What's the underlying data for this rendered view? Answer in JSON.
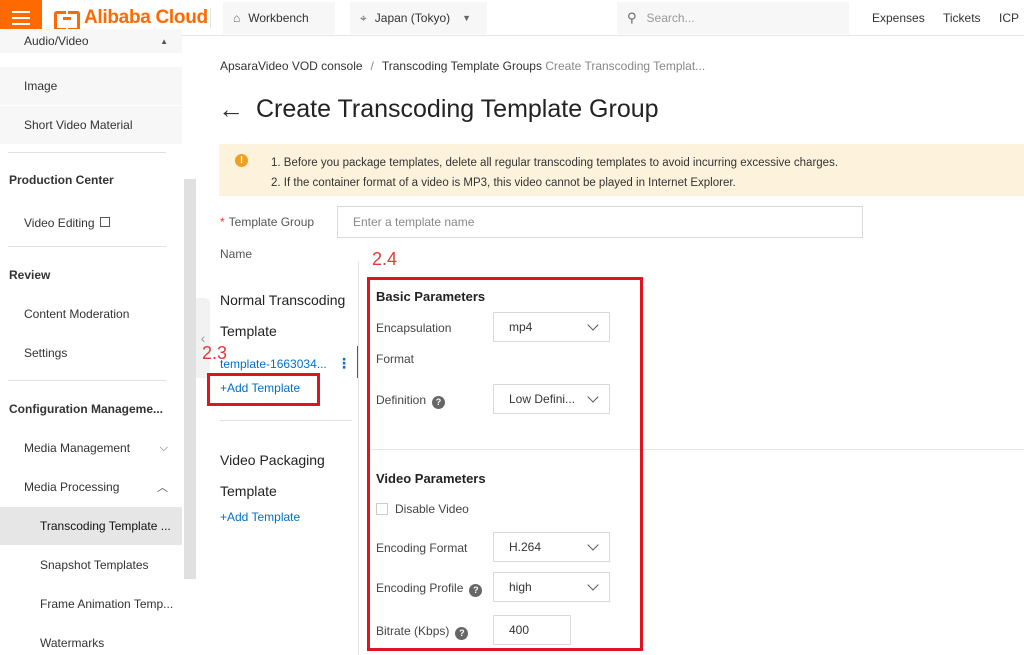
{
  "topbar": {
    "logo_text": "Alibaba Cloud",
    "workbench": "Workbench",
    "region": "Japan (Tokyo)",
    "search_placeholder": "Search...",
    "links": [
      "Expenses",
      "Tickets",
      "ICP"
    ]
  },
  "sidebar": {
    "items_top": [
      "Audio/Video",
      "Image",
      "Short Video Material"
    ],
    "production_center": "Production Center",
    "video_editing": "Video Editing",
    "review": "Review",
    "content_moderation": "Content Moderation",
    "settings": "Settings",
    "config_mgmt": "Configuration Manageme...",
    "media_management": "Media Management",
    "media_processing": "Media Processing",
    "sub_items": [
      "Transcoding Template ...",
      "Snapshot Templates",
      "Frame Animation Temp...",
      "Watermarks"
    ]
  },
  "breadcrumb": {
    "root": "ApsaraVideo VOD console",
    "group": "Transcoding Template Groups",
    "current": "Create Transcoding Templat..."
  },
  "page_title": "Create Transcoding Template Group",
  "notice": {
    "line1": "1. Before you package templates, delete all regular transcoding templates to avoid incurring excessive charges.",
    "line2": "2. If the container format of a video is MP3, this video cannot be played in Internet Explorer."
  },
  "form": {
    "group_label_1": "Template Group",
    "group_label_2": "Name",
    "group_placeholder": "Enter a template name"
  },
  "annotations": {
    "a23": "2.3",
    "a24": "2.4"
  },
  "left_col": {
    "normal_title_1": "Normal Transcoding",
    "normal_title_2": "Template",
    "template_name": "template-1663034...",
    "add_template": "+Add Template",
    "packaging_title_1": "Video Packaging",
    "packaging_title_2": "Template",
    "add_template_2": "+Add Template"
  },
  "basic": {
    "title": "Basic Parameters",
    "encapsulation_1": "Encapsulation",
    "encapsulation_2": "Format",
    "encapsulation_value": "mp4",
    "definition": "Definition",
    "definition_value": "Low Defini..."
  },
  "video": {
    "title": "Video Parameters",
    "disable_video": "Disable Video",
    "encoding_format": "Encoding Format",
    "encoding_format_value": "H.264",
    "encoding_profile": "Encoding Profile",
    "encoding_profile_value": "high",
    "bitrate": "Bitrate (Kbps)",
    "bitrate_value": "400"
  },
  "colors": {
    "brand": "#ff6a00",
    "link": "#0070cc",
    "annotation": "#e6373a",
    "notice_bg": "#fdf3dc"
  }
}
